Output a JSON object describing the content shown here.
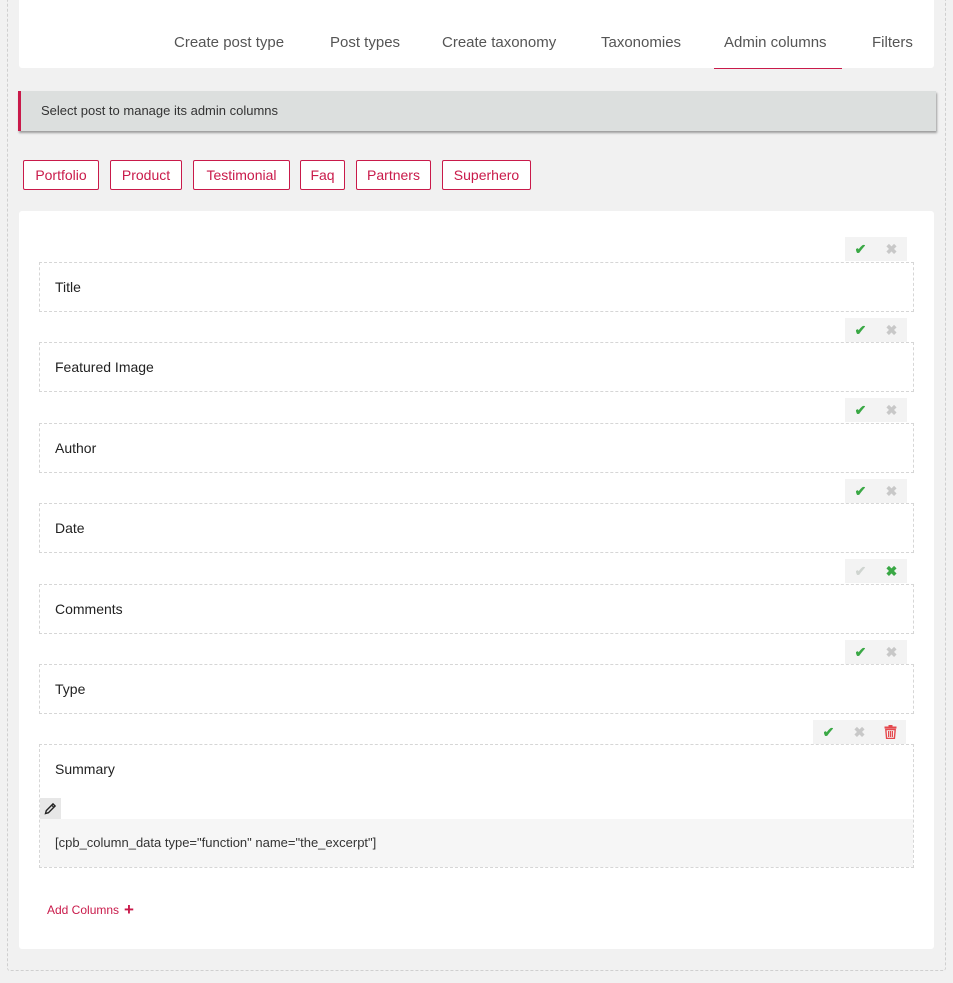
{
  "tabs": [
    "Create post type",
    "Post types",
    "Create taxonomy",
    "Taxonomies",
    "Admin columns",
    "Filters"
  ],
  "active_tab": "Admin columns",
  "notice": "Select post to manage its admin columns",
  "post_types": [
    "Portfolio",
    "Product",
    "Testimonial",
    "Faq",
    "Partners",
    "Superhero"
  ],
  "columns": [
    {
      "label": "Title",
      "state": "enabled"
    },
    {
      "label": "Featured Image",
      "state": "enabled"
    },
    {
      "label": "Author",
      "state": "enabled"
    },
    {
      "label": "Date",
      "state": "enabled"
    },
    {
      "label": "Comments",
      "state": "disabled"
    },
    {
      "label": "Type",
      "state": "enabled"
    },
    {
      "label": "Summary",
      "state": "enabled",
      "custom": true,
      "content": "[cpb_column_data type=\"function\" name=\"the_excerpt\"]"
    }
  ],
  "icons": {
    "check": "check-icon",
    "close": "close-icon",
    "delete": "trash-icon",
    "edit": "pencil-icon",
    "add": "plus-icon"
  },
  "add_columns": "Add Columns",
  "colors": {
    "accent": "#c91a4a",
    "enabled": "#3aa845",
    "inactive": "#c8c8c8",
    "delete": "#e5484d"
  }
}
